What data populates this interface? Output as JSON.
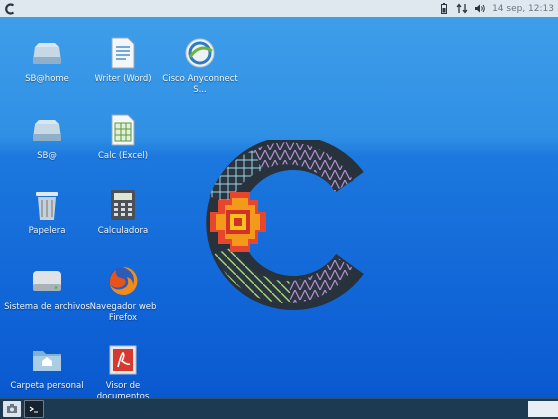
{
  "topbar": {
    "clock": "14 sep, 12:13",
    "icons": [
      "app-logo-icon",
      "battery-icon",
      "network-arrows-icon",
      "volume-icon"
    ]
  },
  "desktop": {
    "icons": [
      {
        "label": "SB@home",
        "icon": "drive-icon"
      },
      {
        "label": "Writer (Word)",
        "icon": "document-icon"
      },
      {
        "label": "Cisco Anyconnect S...",
        "icon": "cisco-anyconnect-icon"
      },
      {
        "label": "SB@",
        "icon": "drive-icon"
      },
      {
        "label": "Calc (Excel)",
        "icon": "spreadsheet-icon"
      },
      {
        "label": "Papelera",
        "icon": "trash-icon"
      },
      {
        "label": "Calculadora",
        "icon": "calculator-icon"
      },
      {
        "label": "Sistema de archivos",
        "icon": "hard-disk-icon"
      },
      {
        "label": "Navegador web Firefox",
        "icon": "firefox-icon"
      },
      {
        "label": "Carpeta personal",
        "icon": "home-folder-icon"
      },
      {
        "label": "Visor de documentos",
        "icon": "pdf-viewer-icon"
      }
    ]
  },
  "taskbar": {
    "items": [
      "show-desktop-icon",
      "terminal-icon"
    ]
  },
  "colors": {
    "desktop_top": "#3f9ee9",
    "desktop_bottom": "#0a58cf",
    "taskbar": "#1d3a53",
    "topbar": "#dfe7ef"
  }
}
